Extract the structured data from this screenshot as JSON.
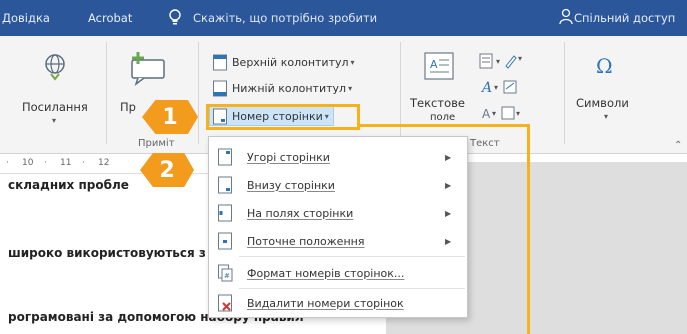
{
  "tabbar": {
    "tab_reference": "Довідка",
    "tab_acrobat": "Acrobat",
    "tell_me": "Скажіть, що потрібно зробити",
    "share": "Спільний доступ"
  },
  "ribbon": {
    "links_label": "Посилання",
    "comment_partial": "Пр",
    "header_label": "Верхній колонтитул",
    "footer_label": "Нижній колонтитул",
    "page_number_label": "Номер сторінки",
    "textbox_label_1": "Текстове",
    "textbox_label_2": "поле",
    "symbols_label": "Символи",
    "group_comments_partial": "Приміт",
    "group_text": "Текст"
  },
  "ruler": {
    "ticks": [
      "10",
      "11",
      "12"
    ]
  },
  "document": {
    "line1": "складних пробле",
    "line2": "широко використовуються з",
    "line3": "рограмовані за допомогою набору правил"
  },
  "menu": {
    "items": [
      {
        "label": "Угорі сторінки",
        "submenu": true
      },
      {
        "label": "Внизу сторінки",
        "submenu": true
      },
      {
        "label": "На полях сторінки",
        "submenu": true
      },
      {
        "label": "Поточне положення",
        "submenu": true
      },
      {
        "label": "Формат номерів сторінок...",
        "submenu": false
      },
      {
        "label": "Видалити номери сторінок",
        "submenu": false
      }
    ]
  },
  "callouts": {
    "step1": "1",
    "step2": "2"
  },
  "colors": {
    "tabbar": "#2b579a",
    "accent_orange": "#f29b1d",
    "frame_yellow": "#f5b21b",
    "highlight": "#cce4f7"
  }
}
